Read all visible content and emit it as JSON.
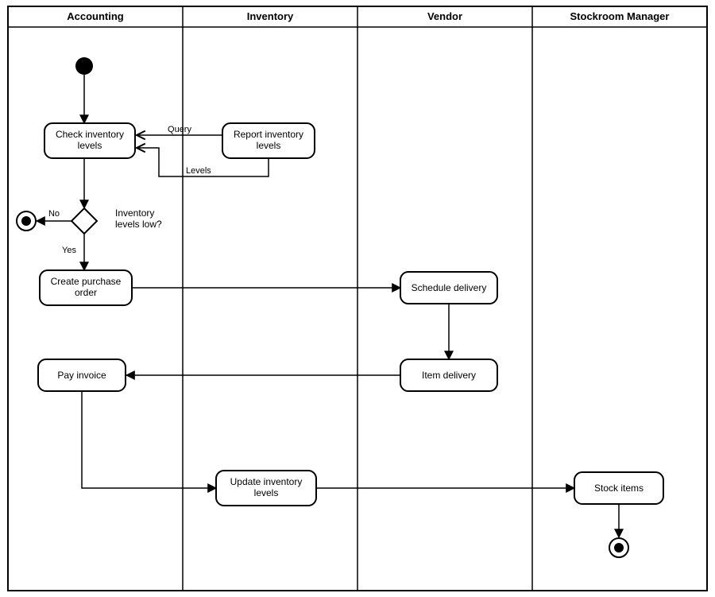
{
  "swimlanes": [
    {
      "id": "accounting",
      "label": "Accounting"
    },
    {
      "id": "inventory",
      "label": "Inventory"
    },
    {
      "id": "vendor",
      "label": "Vendor"
    },
    {
      "id": "stockroom",
      "label": "Stockroom Manager"
    }
  ],
  "nodes": {
    "check_inventory": "Check inventory levels",
    "report_inventory": "Report inventory levels",
    "decision_label": "Inventory levels low?",
    "create_po": "Create purchase order",
    "schedule_delivery": "Schedule delivery",
    "item_delivery": "Item delivery",
    "pay_invoice": "Pay invoice",
    "update_inventory": "Update inventory levels",
    "stock_items": "Stock items"
  },
  "edges": {
    "query": "Query",
    "levels": "Levels",
    "no": "No",
    "yes": "Yes"
  }
}
